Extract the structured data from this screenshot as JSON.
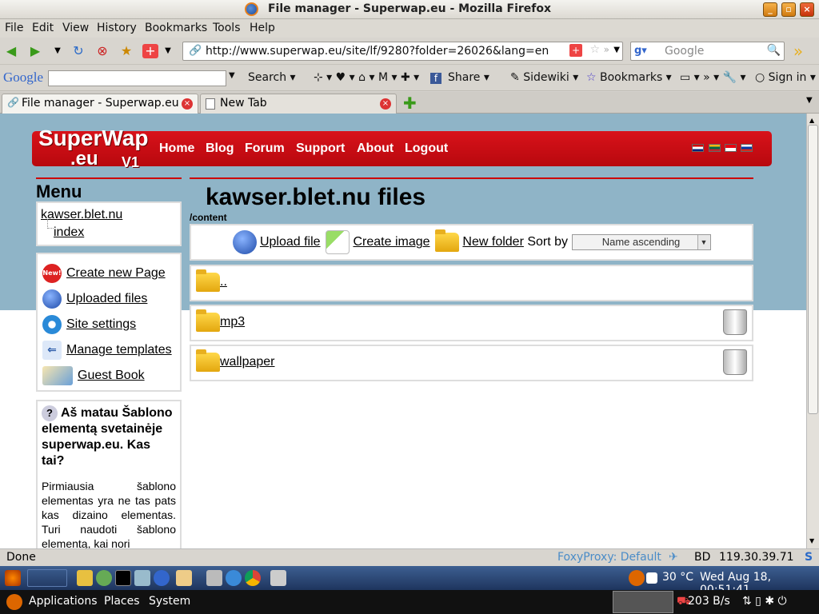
{
  "window": {
    "title": "File manager - Superwap.eu - Mozilla Firefox"
  },
  "menubar": [
    "File",
    "Edit",
    "View",
    "History",
    "Bookmarks",
    "Tools",
    "Help"
  ],
  "nav": {
    "url": "http://www.superwap.eu/site/lf/9280?folder=26026&lang=en",
    "search_placeholder": "Google"
  },
  "google_toolbar": {
    "logo": "Google",
    "search": "Search",
    "share": "Share",
    "sidewiki": "Sidewiki",
    "bookmarks": "Bookmarks",
    "signin": "Sign in"
  },
  "tabs": [
    {
      "label": "File manager - Superwap.eu"
    },
    {
      "label": "New Tab"
    }
  ],
  "site": {
    "logo_line1": "SuperWap",
    "logo_line2": ".eu",
    "logo_v": "V1",
    "nav": [
      "Home",
      "Blog",
      "Forum",
      "Support",
      "About",
      "Logout"
    ],
    "colors": {
      "header": "#c40c12",
      "band": "#8fb4c7"
    }
  },
  "sidebar": {
    "menu_title": "Menu",
    "site_link": "kawser.blet.nu",
    "index_link": "index",
    "items": [
      "Create new Page",
      "Uploaded files",
      "Site settings",
      "Manage templates",
      "Guest Book"
    ],
    "info_title": "Aš matau Šablono elementą svetainėje superwap.eu. Kas tai?",
    "info_text": "Pirmiausia šablono elementas yra ne tas pats kas dizaino elementas. Turi naudoti šablono elementą, kai nori"
  },
  "main": {
    "title": "kawser.blet.nu files",
    "path": "/content",
    "upload": "Upload file",
    "create_image": "Create image",
    "new_folder": "New folder",
    "sort_label": "Sort by",
    "sort_value": "Name ascending",
    "folders": [
      {
        "name": ".."
      },
      {
        "name": "mp3"
      },
      {
        "name": "wallpaper"
      }
    ]
  },
  "status": {
    "left": "Done",
    "proxy": "FoxyProxy: Default",
    "country": "BD",
    "ip": "119.30.39.71"
  },
  "panel_top": {
    "temp": "30 °C",
    "clock": "Wed Aug 18, 00:51:41"
  },
  "panel_bottom": {
    "applications": "Applications",
    "places": "Places",
    "system": "System",
    "net": "203 B/s"
  }
}
